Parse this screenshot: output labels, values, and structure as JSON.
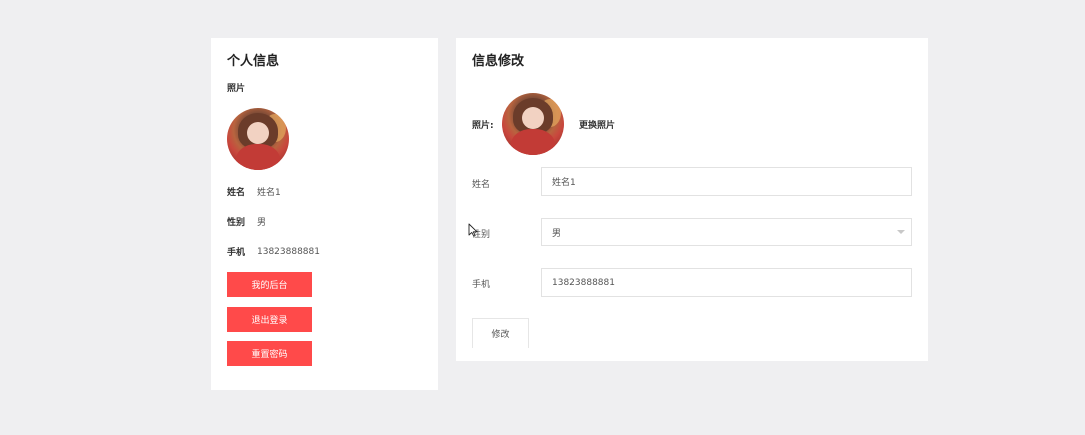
{
  "profile": {
    "title": "个人信息",
    "photo_label": "照片",
    "name_label": "姓名",
    "name_value": "姓名1",
    "gender_label": "性别",
    "gender_value": "男",
    "phone_label": "手机",
    "phone_value": "13823888881",
    "buttons": {
      "backend": "我的后台",
      "logout": "退出登录",
      "reset_password": "重置密码"
    },
    "accent_color": "#ff4a4a"
  },
  "edit": {
    "title": "信息修改",
    "photo_label": "照片:",
    "change_photo": "更换照片",
    "name_label": "姓名",
    "name_value": "姓名1",
    "gender_label": "性别",
    "gender_value": "男",
    "phone_label": "手机",
    "phone_value": "13823888881",
    "submit": "修改"
  }
}
